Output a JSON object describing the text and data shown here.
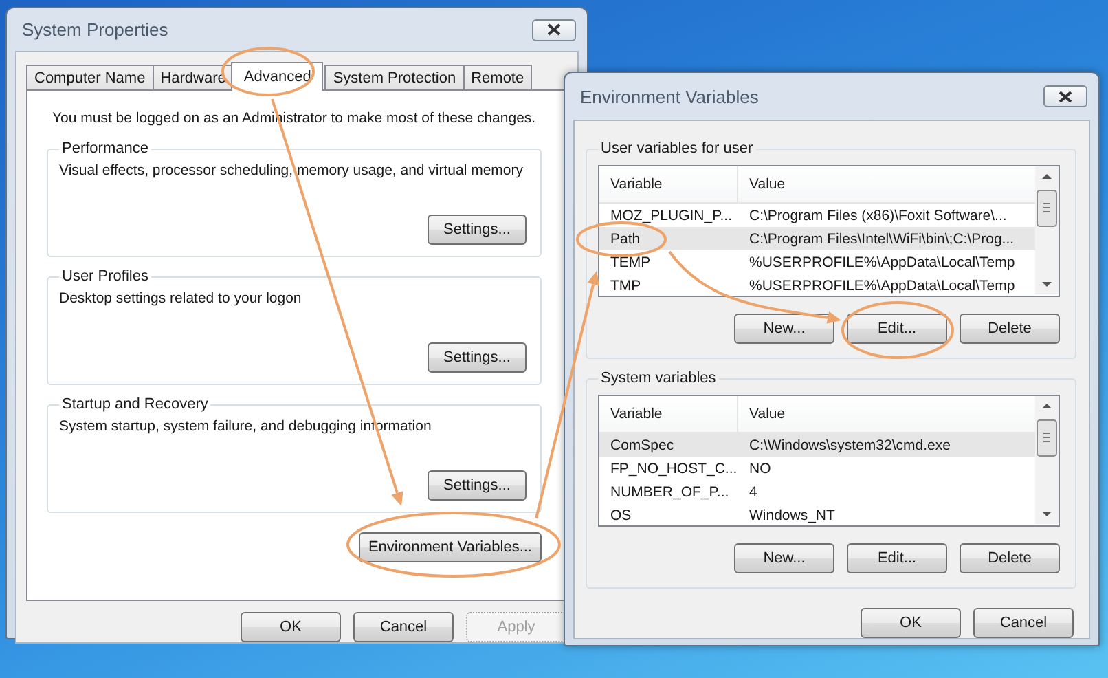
{
  "system_properties": {
    "title": "System Properties",
    "tabs": [
      {
        "label": "Computer Name",
        "selected": false
      },
      {
        "label": "Hardware",
        "selected": false
      },
      {
        "label": "Advanced",
        "selected": true
      },
      {
        "label": "System Protection",
        "selected": false
      },
      {
        "label": "Remote",
        "selected": false
      }
    ],
    "notice": "You must be logged on as an Administrator to make most of these changes.",
    "groups": [
      {
        "title": "Performance",
        "description": "Visual effects, processor scheduling, memory usage, and virtual memory",
        "button": "Settings..."
      },
      {
        "title": "User Profiles",
        "description": "Desktop settings related to your logon",
        "button": "Settings..."
      },
      {
        "title": "Startup and Recovery",
        "description": "System startup, system failure, and debugging information",
        "button": "Settings..."
      }
    ],
    "env_button": "Environment Variables...",
    "buttons": [
      {
        "label": "OK",
        "disabled": false
      },
      {
        "label": "Cancel",
        "disabled": false
      },
      {
        "label": "Apply",
        "disabled": true
      }
    ]
  },
  "environment_variables": {
    "title": "Environment Variables",
    "sections": [
      {
        "title": "User variables for user",
        "columns": [
          "Variable",
          "Value"
        ],
        "rows": [
          {
            "variable": "MOZ_PLUGIN_P...",
            "value": "C:\\Program Files (x86)\\Foxit Software\\...",
            "selected": false
          },
          {
            "variable": "Path",
            "value": "C:\\Program Files\\Intel\\WiFi\\bin\\;C:\\Prog...",
            "selected": true
          },
          {
            "variable": "TEMP",
            "value": "%USERPROFILE%\\AppData\\Local\\Temp",
            "selected": false
          },
          {
            "variable": "TMP",
            "value": "%USERPROFILE%\\AppData\\Local\\Temp",
            "selected": false
          }
        ],
        "buttons": [
          "New...",
          "Edit...",
          "Delete"
        ]
      },
      {
        "title": "System variables",
        "columns": [
          "Variable",
          "Value"
        ],
        "rows": [
          {
            "variable": "ComSpec",
            "value": "C:\\Windows\\system32\\cmd.exe",
            "selected": true
          },
          {
            "variable": "FP_NO_HOST_C...",
            "value": "NO",
            "selected": false
          },
          {
            "variable": "NUMBER_OF_P...",
            "value": "4",
            "selected": false
          },
          {
            "variable": "OS",
            "value": "Windows_NT",
            "selected": false
          }
        ],
        "buttons": [
          "New...",
          "Edit...",
          "Delete"
        ]
      }
    ],
    "buttons": [
      "OK",
      "Cancel"
    ]
  }
}
